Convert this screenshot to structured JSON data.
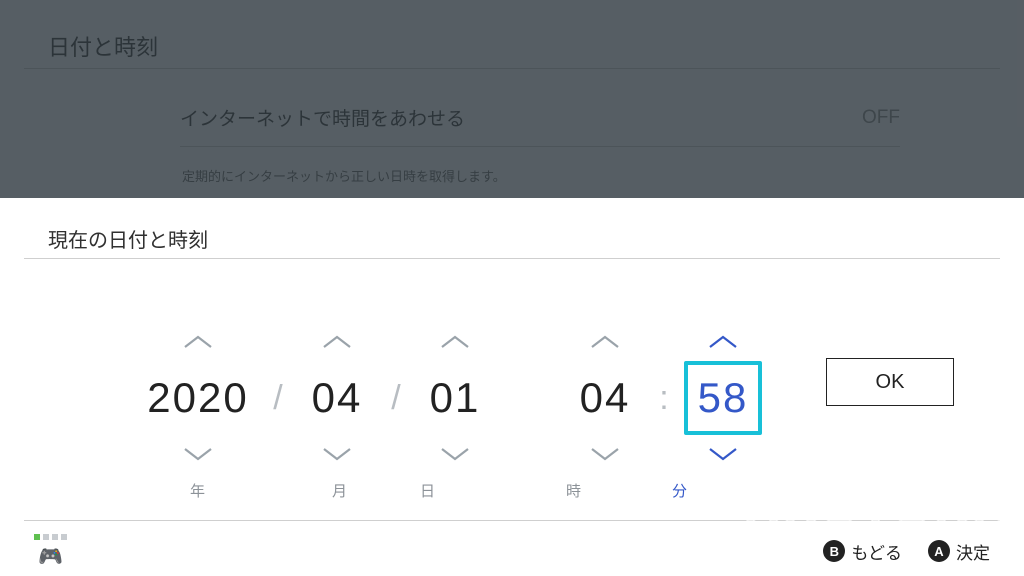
{
  "header": {
    "title": "日付と時刻",
    "sync_label": "インターネットで時間をあわせる",
    "sync_value": "OFF",
    "sync_desc": "定期的にインターネットから正しい日時を取得します。"
  },
  "dialog": {
    "title": "現在の日付と時刻",
    "values": {
      "year": "2020",
      "month": "04",
      "day": "01",
      "hour": "04",
      "minute": "58"
    },
    "labels": {
      "year": "年",
      "month": "月",
      "day": "日",
      "hour": "時",
      "minute": "分"
    },
    "separators": {
      "slash": "/",
      "colon": ":"
    },
    "ok": "OK"
  },
  "footer": {
    "b_btn": "B",
    "b_label": "もどる",
    "a_btn": "A",
    "a_label": "決定"
  },
  "watermark": "ARUTORA"
}
